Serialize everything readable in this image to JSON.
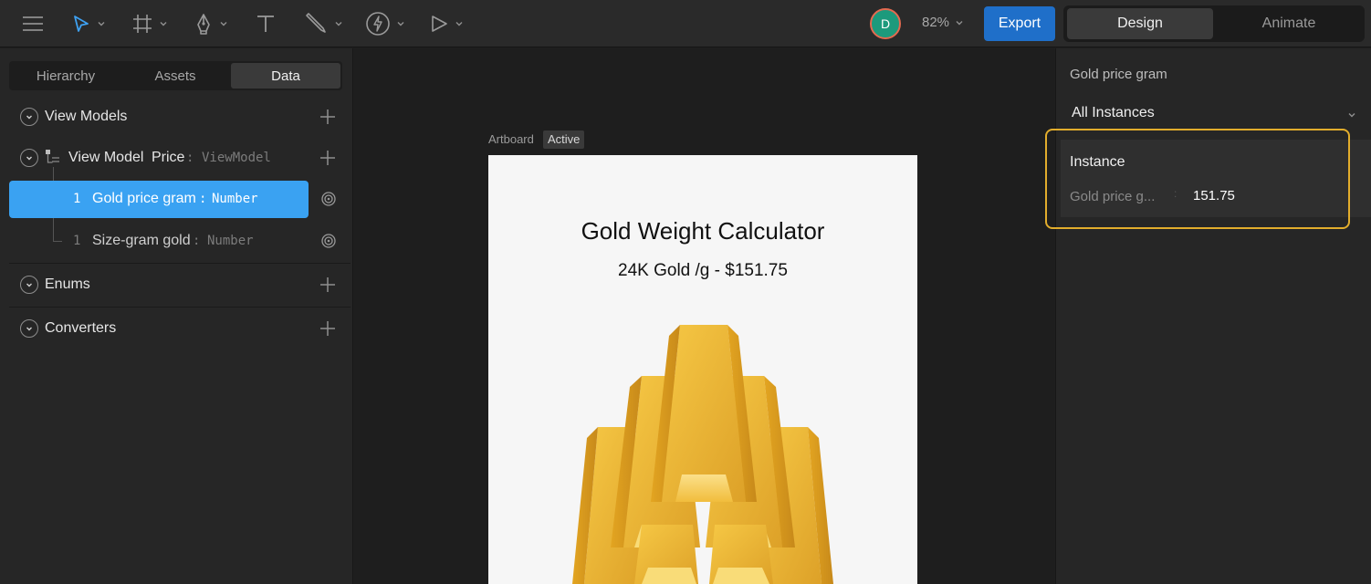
{
  "toolbar": {
    "menu_icon": "hamburger-menu-icon",
    "tools": [
      "select-arrow-icon",
      "artboard-frame-icon",
      "pen-tool-icon",
      "text-tool-icon",
      "brush-tool-icon",
      "lightning-icon",
      "play-icon"
    ],
    "avatar_initial": "D",
    "zoom": "82%",
    "export_label": "Export",
    "mode_design": "Design",
    "mode_animate": "Animate",
    "accent_color": "#1f6fc9"
  },
  "left_panel": {
    "tabs": [
      {
        "label": "Hierarchy"
      },
      {
        "label": "Assets"
      },
      {
        "label": "Data"
      }
    ],
    "sections": {
      "view_models": "View Models",
      "enums": "Enums",
      "converters": "Converters"
    },
    "view_model": {
      "label": "View Model",
      "name": "Price",
      "sep": ":",
      "type": "ViewModel"
    },
    "properties": [
      {
        "index": "1",
        "name": "Gold price gram",
        "sep": ":",
        "type": "Number"
      },
      {
        "index": "1",
        "name": "Size-gram gold",
        "sep": ":",
        "type": "Number"
      }
    ],
    "selected_color": "#3aa2f2"
  },
  "canvas": {
    "artboard_label": "Artboard",
    "active_badge": "Active",
    "title": "Gold Weight Calculator",
    "subtitle": "24K Gold /g - $151.75"
  },
  "right_panel": {
    "title": "Gold price gram",
    "instances_select": "All Instances",
    "instance_label": "Instance",
    "property_label": "Gold price g...",
    "property_value": "151.75",
    "highlight_color": "#e2ad2c"
  }
}
